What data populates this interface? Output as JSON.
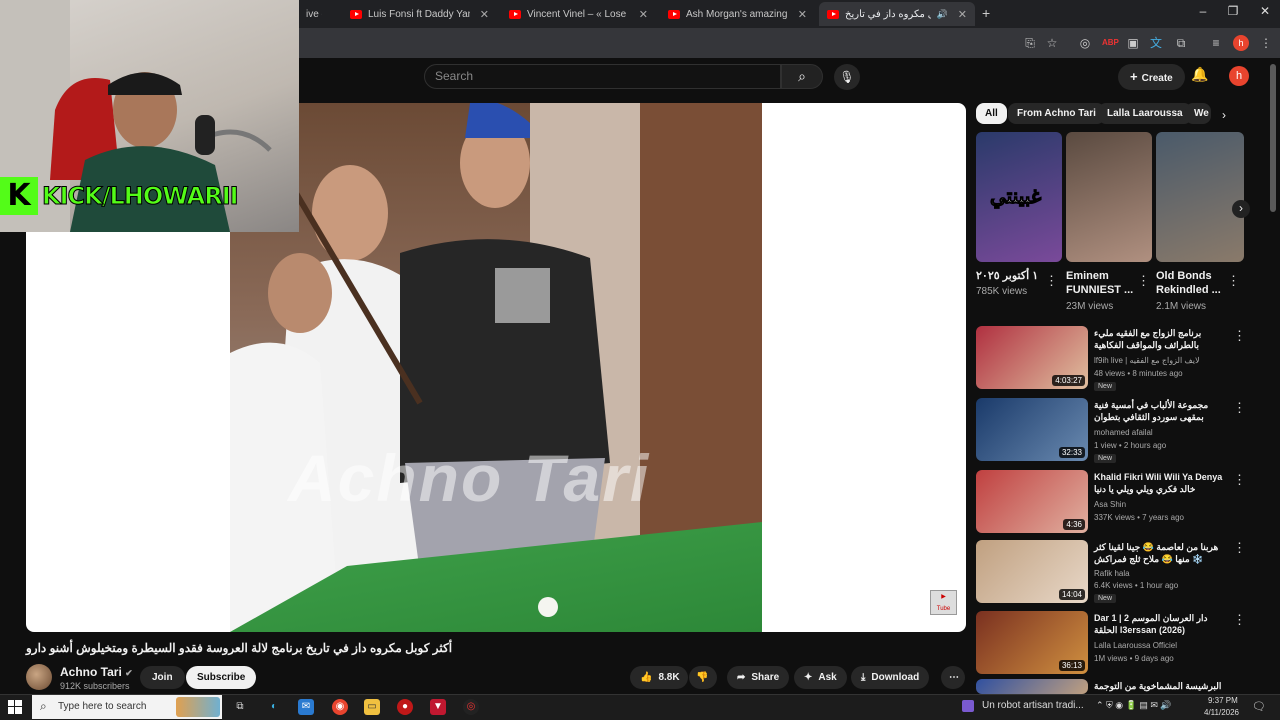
{
  "browser": {
    "tabs": [
      {
        "label": "ive o"
      },
      {
        "label": "Luis Fonsi ft Daddy Yankee – D"
      },
      {
        "label": "Vincent Vinel – « Lose Yourself »"
      },
      {
        "label": "Ash Morgan's amazing perform"
      },
      {
        "label": "أكثر كوبل مكروه داز في تاريخ"
      }
    ],
    "new_tab": "+"
  },
  "youtube": {
    "search_placeholder": "Search",
    "create_label": "Create",
    "avatar_letter": "h"
  },
  "stream_overlay": {
    "logo_letter": "K",
    "handle": "KICK/LHOWARII"
  },
  "video": {
    "watermark": "Achno Tari",
    "title": "أكثر كوبل مكروه داز في تاريخ برنامج لالة العروسة فقدو السيطرة ومتخيلوش أشنو دارو",
    "channel_name": "Achno Tari",
    "channel_subs": "912K subscribers",
    "join_label": "Join",
    "subscribe_label": "Subscribe",
    "likes": "8.8K",
    "share_label": "Share",
    "ask_label": "Ask",
    "download_label": "Download"
  },
  "chips": [
    "All",
    "From Achno Tari",
    "Lalla Laaroussa",
    "We"
  ],
  "shorts": [
    {
      "title": "١ أكتوبر ٢٠٢٥",
      "views": "785K views",
      "overlay": "غبينتي"
    },
    {
      "title": "Eminem FUNNIEST ...",
      "views": "23M views"
    },
    {
      "title": "Old Bonds Rekindled ...",
      "views": "2.1M views"
    }
  ],
  "recommended": [
    {
      "title": "برنامج الزواج مع الفقيه مليء بالطرائف والمواقف الفكاهية",
      "channel": "lf9ih live | لايف الزواج مع الفقيه",
      "meta": "48 views • 8 minutes ago",
      "duration": "4:03:27",
      "badge": "New"
    },
    {
      "title": "مجموعة الألباب في أمسية فنية بمقهى سوردو الثقافي بتطوان",
      "channel": "mohamed afailal",
      "meta": "1 view • 2 hours ago",
      "duration": "32:33",
      "badge": "New"
    },
    {
      "title": "Khalid Fikri Wili Wili Ya Denya خالد فكري ويلي ويلي يا دنيا",
      "channel": "Asa Shin",
      "meta": "337K views • 7 years ago",
      "duration": "4:36",
      "badge": ""
    },
    {
      "title": "هربنا من لعاصمة 😂 جينا لقينا كثر منها 😂 ملاح ثلج فمراكش ❄️",
      "channel": "Rafik hala",
      "meta": "6.4K views • 1 hour ago",
      "duration": "14:04",
      "badge": "New"
    },
    {
      "title": "Dar 1 دار العرسان الموسم 2 | الحلقة l3erssan (2026)",
      "channel": "Lalla Laaroussa Officiel",
      "meta": "1M views • 9 days ago",
      "duration": "36:13",
      "badge": ""
    },
    {
      "title": "البرشيسة المشماخوية من التوجمة فالقيك دوك",
      "channel": "",
      "meta": "",
      "duration": "",
      "badge": ""
    }
  ],
  "taskbar": {
    "search_placeholder": "Type here to search",
    "news": "Un robot artisan tradi...",
    "time": "9:37 PM",
    "date": "4/11/2026"
  }
}
